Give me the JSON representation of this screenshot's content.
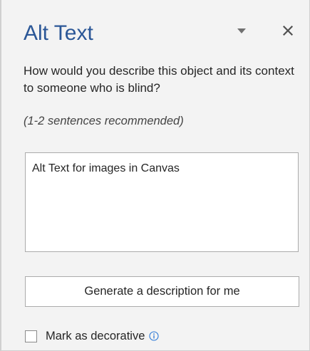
{
  "panel": {
    "title": "Alt Text",
    "dropdown_icon": "caret-down-icon",
    "close_icon": "close-icon"
  },
  "prompt": {
    "question": "How would you describe this object and its context to someone who is blind?",
    "recommendation": "(1-2 sentences recommended)"
  },
  "alt_text_input": {
    "value": "Alt Text for images in Canvas"
  },
  "generate_button": {
    "label": "Generate a description for me"
  },
  "decorative": {
    "label": "Mark as decorative",
    "checked": false,
    "info_icon": "info-icon"
  },
  "colors": {
    "title": "#2b5797",
    "info_icon": "#2b78d6",
    "panel_background": "#f3f3f3"
  }
}
